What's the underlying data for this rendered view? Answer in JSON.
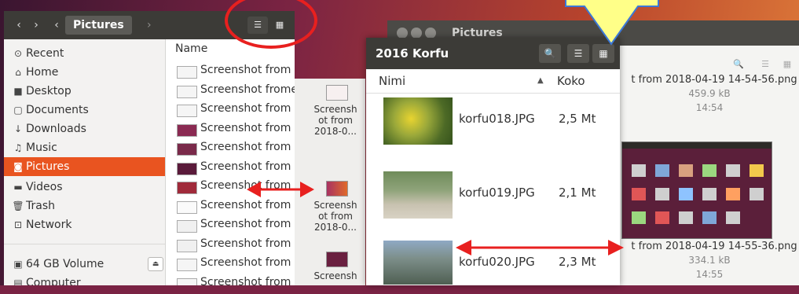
{
  "left_window": {
    "breadcrumb": "Pictures",
    "sidebar": [
      {
        "icon": "clock-icon",
        "glyph": "⊙",
        "label": "Recent"
      },
      {
        "icon": "home-icon",
        "glyph": "⌂",
        "label": "Home"
      },
      {
        "icon": "folder-icon",
        "glyph": "■",
        "label": "Desktop"
      },
      {
        "icon": "document-icon",
        "glyph": "▢",
        "label": "Documents"
      },
      {
        "icon": "download-icon",
        "glyph": "↓",
        "label": "Downloads"
      },
      {
        "icon": "music-icon",
        "glyph": "♫",
        "label": "Music"
      },
      {
        "icon": "camera-icon",
        "glyph": "◙",
        "label": "Pictures"
      },
      {
        "icon": "video-icon",
        "glyph": "▬",
        "label": "Videos"
      },
      {
        "icon": "trash-icon",
        "glyph": "🗑",
        "label": "Trash"
      },
      {
        "icon": "network-icon",
        "glyph": "⊡",
        "label": "Network"
      },
      {
        "icon": "drive-icon",
        "glyph": "▣",
        "label": "64 GB Volume"
      },
      {
        "icon": "computer-icon",
        "glyph": "▤",
        "label": "Computer"
      }
    ],
    "column_name": "Name",
    "files": [
      "Screenshot from",
      "Screenshot fromes",
      "Screenshot from",
      "Screenshot from",
      "Screenshot from",
      "Screenshot from",
      "Screenshot from",
      "Screenshot from",
      "Screenshot from",
      "Screenshot from",
      "Screenshot from",
      "Screenshot from"
    ]
  },
  "strip": {
    "items": [
      "Screensh ot from 2018-0...",
      "Screensh ot from 2018-0...",
      "Screensh"
    ]
  },
  "back_window": {
    "title": "Pictures"
  },
  "front_window": {
    "title": "2016 Korfu",
    "col_name": "Nimi",
    "col_size": "Koko",
    "rows": [
      {
        "name": "korfu018.JPG",
        "size": "2,5 Mt"
      },
      {
        "name": "korfu019.JPG",
        "size": "2,1 Mt"
      },
      {
        "name": "korfu020.JPG",
        "size": "2,3 Mt"
      }
    ]
  },
  "right_grid": {
    "item1_name": "t from 2018-04-19 14-54-56.png",
    "item1_size": "459.9 kB",
    "item1_time": "14:54",
    "item2_name": "t from 2018-04-19 14-55-36.png",
    "item2_size": "334.1 kB",
    "item2_time": "14:55"
  },
  "colors": {
    "accent": "#e95420",
    "annotation_red": "#e8201f",
    "callout_yellow": "#ffff88"
  }
}
